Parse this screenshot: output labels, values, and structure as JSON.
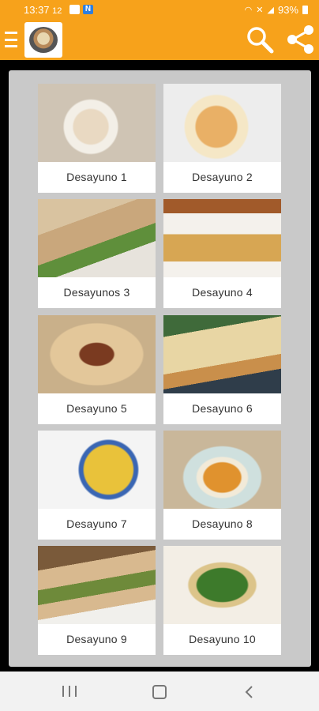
{
  "status_bar": {
    "time": "13:37",
    "extra": "12",
    "battery": "93%",
    "notif_letter": "N"
  },
  "app_bar": {
    "accent": "#f7a21b",
    "menu_icon": "hamburger-menu-icon",
    "logo": "app-logo-oatmeal-bowl",
    "search_icon": "search-icon",
    "share_icon": "share-icon"
  },
  "recipes": [
    {
      "label": "Desayuno 1"
    },
    {
      "label": "Desayuno 2"
    },
    {
      "label": "Desayunos 3"
    },
    {
      "label": "Desayuno 4"
    },
    {
      "label": "Desayuno 5"
    },
    {
      "label": "Desayuno 6"
    },
    {
      "label": "Desayuno 7"
    },
    {
      "label": "Desayuno 8"
    },
    {
      "label": "Desayuno 9"
    },
    {
      "label": "Desayuno 10"
    }
  ],
  "nav_bar": {
    "recents_icon": "recent-apps-icon",
    "home_icon": "home-icon",
    "back_icon": "back-icon"
  }
}
